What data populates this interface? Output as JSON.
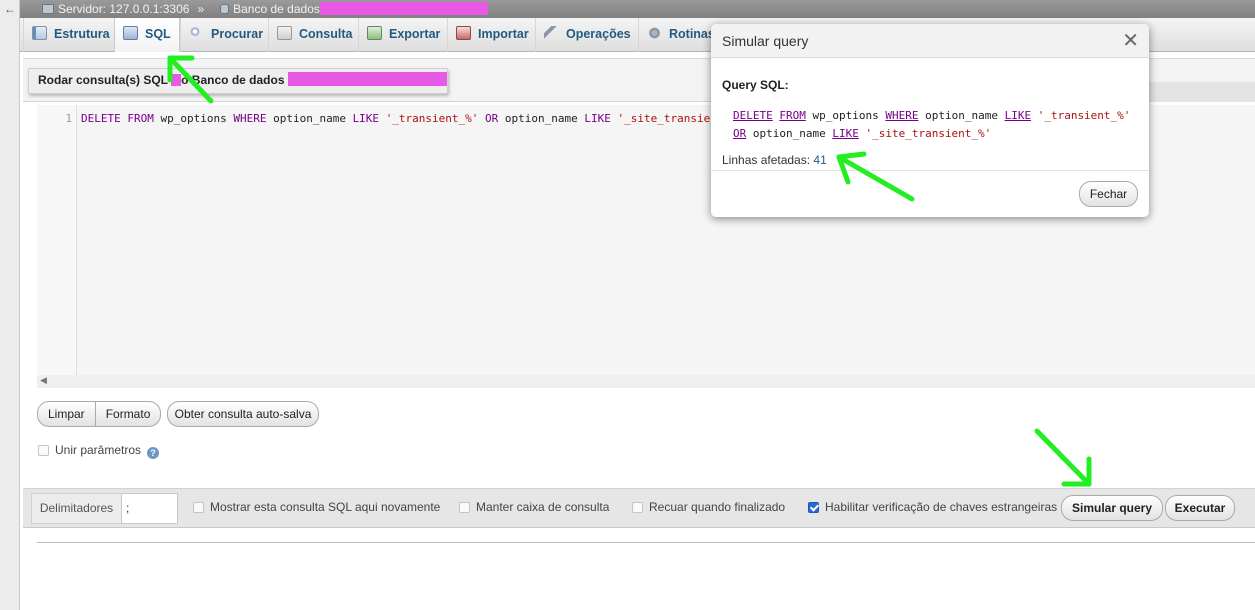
{
  "breadcrumb": {
    "server": "Servidor: 127.0.0.1:3306",
    "separator": "»",
    "database": "Banco de dados"
  },
  "tabs": [
    {
      "label": "Estrutura",
      "icon": "structure-icon"
    },
    {
      "label": "SQL",
      "icon": "sql-icon",
      "active": true
    },
    {
      "label": "Procurar",
      "icon": "search-icon"
    },
    {
      "label": "Consulta",
      "icon": "query-icon"
    },
    {
      "label": "Exportar",
      "icon": "export-icon"
    },
    {
      "label": "Importar",
      "icon": "import-icon"
    },
    {
      "label": "Operações",
      "icon": "wrench-icon"
    },
    {
      "label": "Rotinas",
      "icon": "gear-icon"
    }
  ],
  "query_box": {
    "title_prefix": "Rodar consulta(s) SQL",
    "title_suffix": "o Banco de dados",
    "line_number": "1",
    "sql": {
      "k1": "DELETE FROM",
      "t1": " wp_options ",
      "k2": "WHERE",
      "t2": " option_name ",
      "k3": "LIKE",
      "s1": "'_transient_%'",
      "k4": "OR",
      "t3": " option_name ",
      "k5": "LIKE",
      "s2": "'_site_transient_%'"
    }
  },
  "editor_buttons": {
    "clear": "Limpar",
    "format": "Formato",
    "get_autosaved": "Obter consulta auto-salva"
  },
  "bind_params_label": "Unir parâmetros",
  "footer": {
    "delimiter_label": "Delimitadores",
    "delimiter_value": ";",
    "show_again_label": "Mostrar esta consulta SQL aqui novamente",
    "keep_box_label": "Manter caixa de consulta",
    "rollback_label": "Recuar quando finalizado",
    "fk_checks_label": "Habilitar verificação de chaves estrangeiras",
    "fk_checks_checked": true,
    "simulate_button": "Simular query",
    "execute_button": "Executar"
  },
  "modal": {
    "title": "Simular query",
    "query_label": "Query SQL:",
    "sql_line1": {
      "k1": "DELETE",
      "k2": "FROM",
      "t1": " wp_options ",
      "k3": "WHERE",
      "t2": " option_name ",
      "k4": "LIKE",
      "s1": "'_transient_%'"
    },
    "sql_line2": {
      "k1": "OR",
      "t1": " option_name ",
      "k2": "LIKE",
      "s1": "'_site_transient_%'"
    },
    "affected_label": "Linhas afetadas:",
    "affected_value": "41",
    "close_button": "Fechar"
  },
  "annotation_color": "#22ee22",
  "redaction_color": "#e75ae6"
}
